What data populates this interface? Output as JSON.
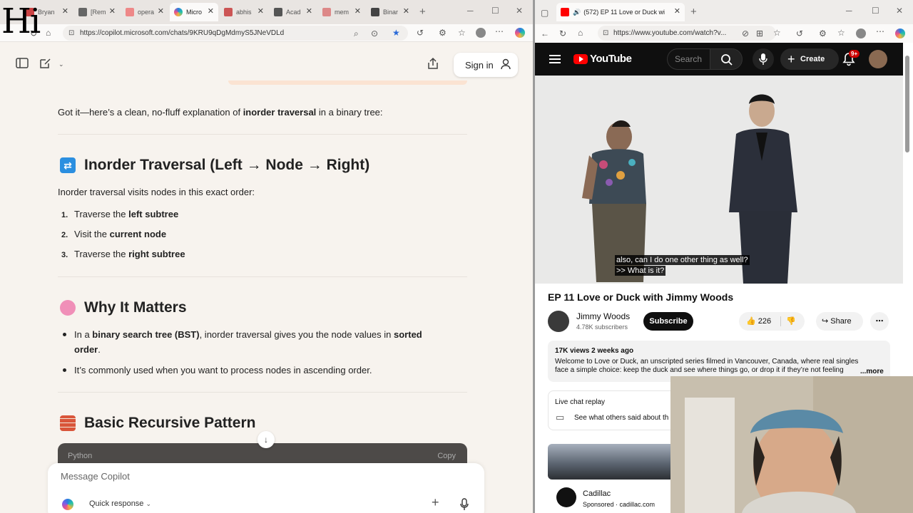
{
  "left_browser": {
    "overlay_logo": "Hi",
    "tabs": [
      {
        "label": "Bryan",
        "color": "#c44"
      },
      {
        "label": "[Rem",
        "color": "#666"
      },
      {
        "label": "opera",
        "color": "#e88"
      },
      {
        "label": "Micro",
        "color": "#2a7de1",
        "active": true
      },
      {
        "label": "abhis",
        "color": "#c55"
      },
      {
        "label": "Acad",
        "color": "#555"
      },
      {
        "label": "mem",
        "color": "#d88"
      },
      {
        "label": "Binar",
        "color": "#444"
      }
    ],
    "url": "https://copilot.microsoft.com/chats/9KRU9qDgMdmyS5JNeVDLd",
    "sign_in_label": "Sign in"
  },
  "chat": {
    "intro": {
      "p1": "Got it—here’s a clean, no-fluff explanation of ",
      "b1": "inorder traversal",
      "p2": " in a binary tree:"
    },
    "section1": {
      "heading": "Inorder Traversal (Left → Node → Right)",
      "lead": "Inorder traversal visits nodes in this exact order:",
      "steps": [
        {
          "num": "1.",
          "pre": "Traverse the ",
          "bold": "left subtree"
        },
        {
          "num": "2.",
          "pre": "Visit the ",
          "bold": "current node"
        },
        {
          "num": "3.",
          "pre": "Traverse the ",
          "bold": "right subtree"
        }
      ]
    },
    "section2": {
      "heading": "Why It Matters",
      "bullet1": {
        "p1": "In a ",
        "b1": "binary search tree (BST)",
        "p2": ", inorder traversal gives you the node values in ",
        "b2": "sorted",
        "b3": "order",
        "p3": "."
      },
      "bullet2": "It’s commonly used when you want to process nodes in ascending order."
    },
    "section3": {
      "heading": "Basic Recursive Pattern"
    },
    "code_lang": "Python",
    "code_copy": "Copy"
  },
  "composer": {
    "placeholder": "Message Copilot",
    "mode_label": "Quick response"
  },
  "right_browser": {
    "tab_title": "(572) EP 11 Love or Duck wi",
    "url": "https://www.youtube.com/watch?v...",
    "yt_brand": "YouTube",
    "search_placeholder": "Search",
    "create_label": "Create",
    "notif_badge": "9+",
    "video": {
      "caption_line1": "also, can I do one other thing as well?",
      "caption_line2": ">> What is it?",
      "title": "EP 11 Love or Duck with Jimmy Woods",
      "channel": "Jimmy Woods",
      "subscribers": "4.78K subscribers",
      "subscribe_label": "Subscribe",
      "likes": "226",
      "share_label": "Share",
      "views_meta": "17K views  2 weeks ago",
      "description": "Welcome to Love or Duck, an unscripted series filmed in Vancouver, Canada, where real singles face a simple choice: keep the duck and see where things go, or drop it if they’re not feeling",
      "more_label": "...more",
      "live_chat_title": "Live chat replay",
      "live_chat_sub": "See what others said about th"
    },
    "ad": {
      "name": "Cadillac",
      "sponsored": "Sponsored · cadillac.com"
    }
  },
  "colors": {
    "copilot_bg": "#f7f3ee",
    "yt_header": "#0f0f0f",
    "yt_red": "#ff0000",
    "code_bar": "#4d4a48"
  }
}
